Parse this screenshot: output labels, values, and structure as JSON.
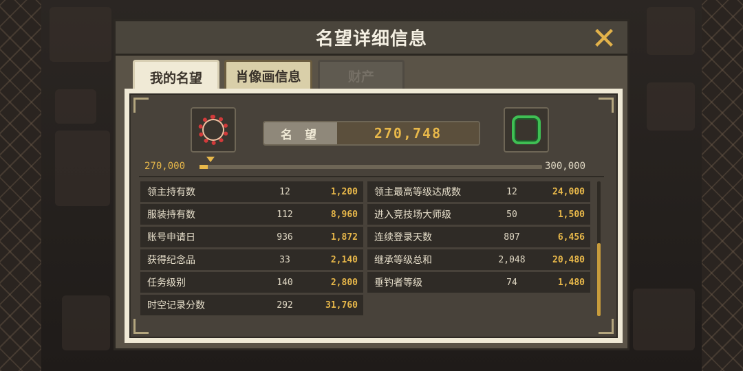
{
  "dialog": {
    "title": "名望详细信息",
    "close_icon": "close-icon"
  },
  "tabs": [
    {
      "label": "我的名望",
      "active": true
    },
    {
      "label": "肖像画信息",
      "active": false
    },
    {
      "label": "财产",
      "active": false
    }
  ],
  "reputation": {
    "label": "名 望",
    "value": "270,748",
    "current_rank_icon": "red-laurel-icon",
    "next_rank_icon": "green-frame-icon"
  },
  "progress": {
    "min": "270,000",
    "max": "300,000",
    "fraction": 0.025
  },
  "stats_left": [
    {
      "label": "领主持有数",
      "count": "12",
      "points": "1,200"
    },
    {
      "label": "服装持有数",
      "count": "112",
      "points": "8,960"
    },
    {
      "label": "账号申请日",
      "count": "936",
      "points": "1,872"
    },
    {
      "label": "获得纪念品",
      "count": "33",
      "points": "2,140"
    },
    {
      "label": "任务级别",
      "count": "140",
      "points": "2,800"
    },
    {
      "label": "时空记录分数",
      "count": "292",
      "points": "31,760"
    }
  ],
  "stats_right": [
    {
      "label": "领主最高等级达成数",
      "count": "12",
      "points": "24,000"
    },
    {
      "label": "进入竞技场大师级",
      "count": "50",
      "points": "1,500"
    },
    {
      "label": "连续登录天数",
      "count": "807",
      "points": "6,456"
    },
    {
      "label": "继承等级总和",
      "count": "2,048",
      "points": "20,480"
    },
    {
      "label": "垂钓者等级",
      "count": "74",
      "points": "1,480"
    }
  ],
  "colors": {
    "accent_gold": "#e8b84a",
    "panel_dark": "#48423a",
    "panel_light": "#f0ead6"
  }
}
